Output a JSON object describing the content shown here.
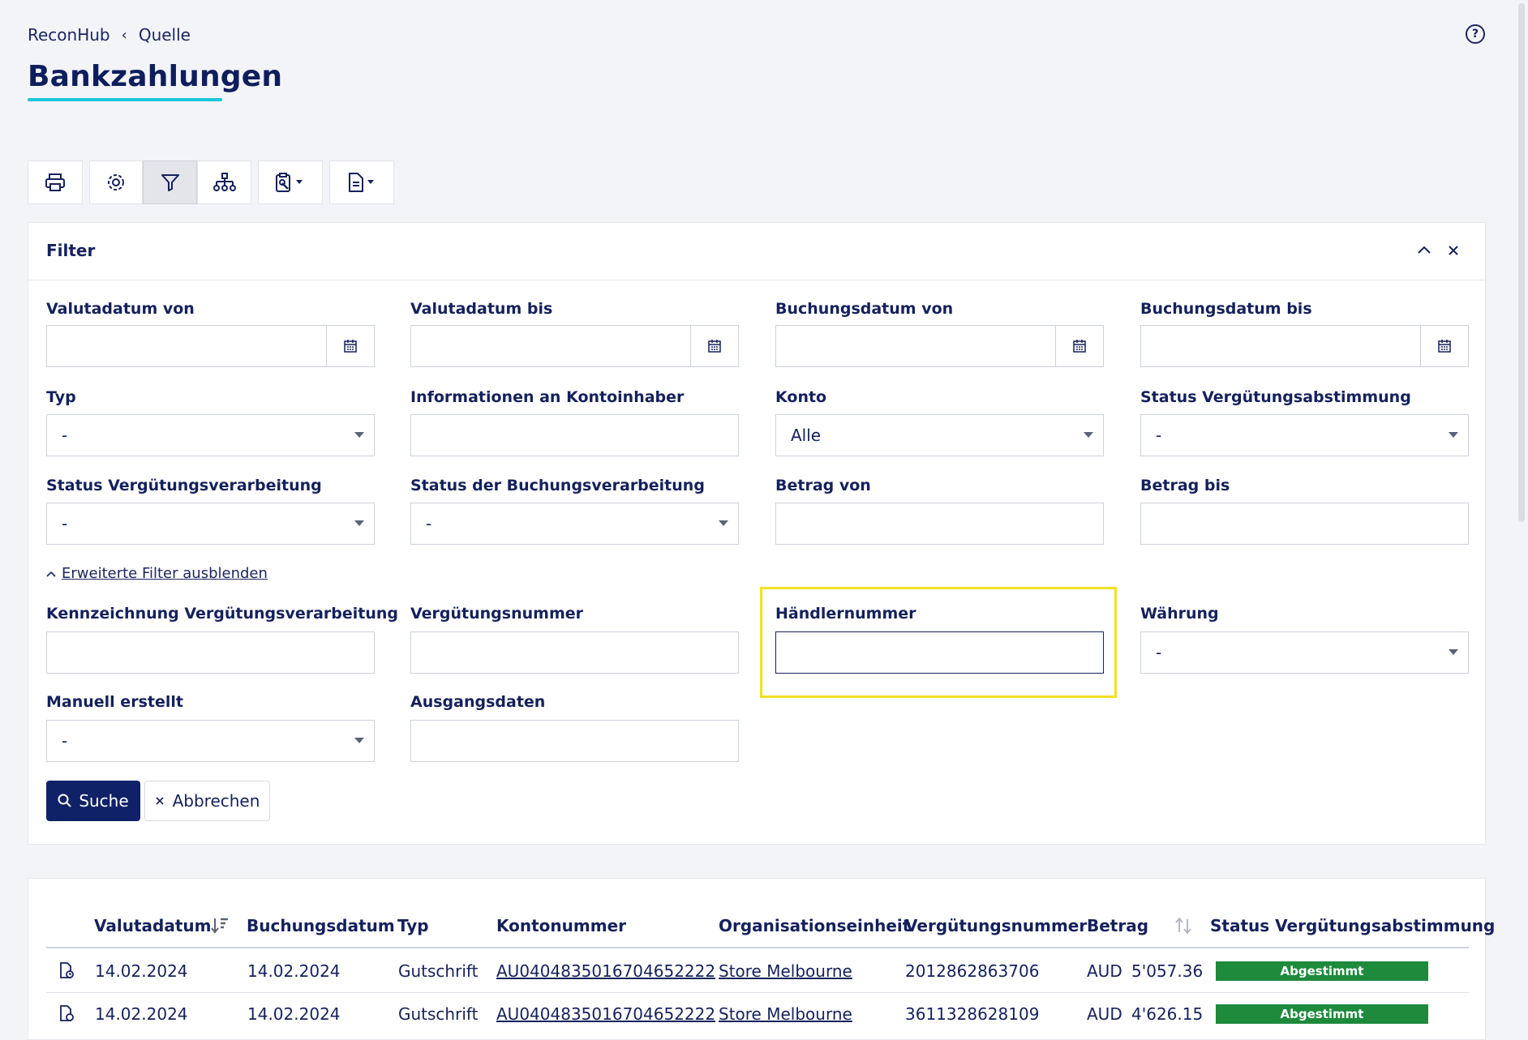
{
  "breadcrumb": {
    "root": "ReconHub",
    "current": "Quelle"
  },
  "page": {
    "title": "Bankzahlungen"
  },
  "filter": {
    "title": "Filter",
    "fields": {
      "valutadatum_von": {
        "label": "Valutadatum von",
        "value": ""
      },
      "valutadatum_bis": {
        "label": "Valutadatum bis",
        "value": ""
      },
      "buchungsdatum_von": {
        "label": "Buchungsdatum von",
        "value": ""
      },
      "buchungsdatum_bis": {
        "label": "Buchungsdatum bis",
        "value": ""
      },
      "typ": {
        "label": "Typ",
        "value": "-"
      },
      "info_kontoinhaber": {
        "label": "Informationen an Kontoinhaber",
        "value": ""
      },
      "konto": {
        "label": "Konto",
        "value": "Alle"
      },
      "status_verguetungsabstimmung": {
        "label": "Status Vergütungsabstimmung",
        "value": "-"
      },
      "status_verguetungsverarbeitung": {
        "label": "Status Vergütungsverarbeitung",
        "value": "-"
      },
      "status_buchungsverarbeitung": {
        "label": "Status der Buchungsverarbeitung",
        "value": "-"
      },
      "betrag_von": {
        "label": "Betrag von",
        "value": ""
      },
      "betrag_bis": {
        "label": "Betrag bis",
        "value": ""
      },
      "kennzeichnung": {
        "label": "Kennzeichnung Vergütungsverarbeitung",
        "value": ""
      },
      "verguetungsnummer": {
        "label": "Vergütungsnummer",
        "value": ""
      },
      "haendlernummer": {
        "label": "Händlernummer",
        "value": ""
      },
      "waehrung": {
        "label": "Währung",
        "value": "-"
      },
      "manuell_erstellt": {
        "label": "Manuell erstellt",
        "value": "-"
      },
      "ausgangsdaten": {
        "label": "Ausgangsdaten",
        "value": ""
      }
    },
    "advanced_toggle": "Erweiterte Filter ausblenden",
    "search_label": "Suche",
    "cancel_label": "Abbrechen"
  },
  "table": {
    "headers": {
      "valutadatum": "Valutadatum",
      "buchungsdatum": "Buchungsdatum",
      "typ": "Typ",
      "kontonummer": "Kontonummer",
      "organisationseinheit": "Organisationseinheit",
      "verguetungsnummer": "Vergütungsnummer",
      "betrag": "Betrag",
      "status": "Status Vergütungsabstimmung"
    },
    "rows": [
      {
        "valutadatum": "14.02.2024",
        "buchungsdatum": "14.02.2024",
        "typ": "Gutschrift",
        "kontonummer": "AU0404835016704652222",
        "organisationseinheit": "Store Melbourne",
        "verguetungsnummer": "2012862863706",
        "currency": "AUD",
        "betrag": "5'057.36",
        "status": "Abgestimmt"
      },
      {
        "valutadatum": "14.02.2024",
        "buchungsdatum": "14.02.2024",
        "typ": "Gutschrift",
        "kontonummer": "AU0404835016704652222",
        "organisationseinheit": "Store Melbourne",
        "verguetungsnummer": "3611328628109",
        "currency": "AUD",
        "betrag": "4'626.15",
        "status": "Abgestimmt"
      }
    ]
  },
  "colors": {
    "primary": "#0f2167",
    "accent_underline": "#19c6d6",
    "status_green": "#1d8a3c",
    "highlight": "#f4e025"
  }
}
